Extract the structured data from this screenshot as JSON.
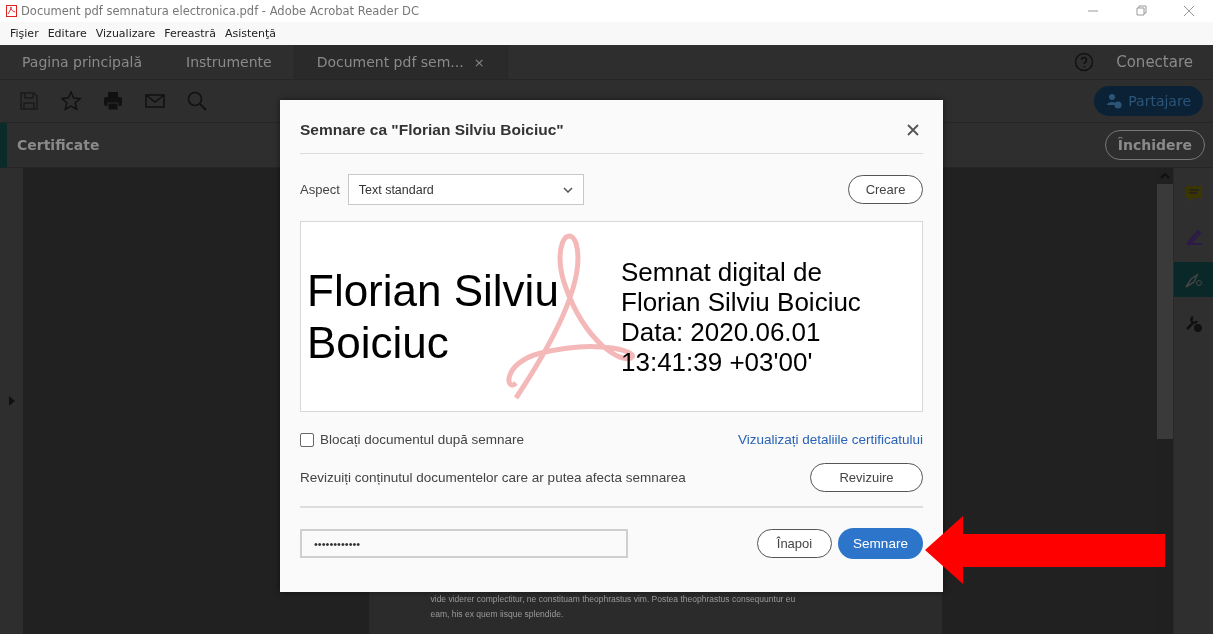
{
  "window": {
    "title": "Document pdf semnatura electronica.pdf - Adobe Acrobat Reader DC"
  },
  "menu": [
    "Fişier",
    "Editare",
    "Vizualizare",
    "Fereastră",
    "Asistenţă"
  ],
  "tabs": [
    {
      "label": "Pagina principală",
      "selected": false
    },
    {
      "label": "Instrumente",
      "selected": false
    },
    {
      "label": "Document pdf sem...",
      "selected": true,
      "close": "×"
    }
  ],
  "header": {
    "signin": "Conectare"
  },
  "toolbar": {
    "share": "Partajare"
  },
  "panel": {
    "title": "Certificate",
    "close": "Închidere"
  },
  "tools": [
    {
      "kind": "comment",
      "selected": false
    },
    {
      "kind": "sign",
      "selected": false
    },
    {
      "kind": "certificate",
      "selected": true
    },
    {
      "kind": "more",
      "selected": false
    }
  ],
  "document": {
    "lines": [
      "vide viderer complectitur, ne constituam theophrastus vim. Postea theophrastus consequuntur eu",
      "eam, his ex quem iisque splendide."
    ]
  },
  "dialog": {
    "title": "Semnare ca \"Florian Silviu Boiciuc\"",
    "appearance_label": "Aspect",
    "appearance": "Text standard",
    "create": "Creare",
    "preview": {
      "name_lines": [
        "Florian Silviu",
        "Boiciuc"
      ],
      "details": [
        "Semnat digital de",
        "Florian Silviu Boiciuc",
        "Data: 2020.06.01",
        "13:41:39 +03'00'"
      ]
    },
    "lock": {
      "label": "Blocați documentul după semnare",
      "checked": false
    },
    "details_link": "Vizualizați detaliile certificatului",
    "review_text": "Revizuiți conținutul documentelor care ar putea afecta semnarea",
    "review": "Revizuire",
    "password": "••••••••••••",
    "back": "Înapoi",
    "sign": "Semnare"
  }
}
